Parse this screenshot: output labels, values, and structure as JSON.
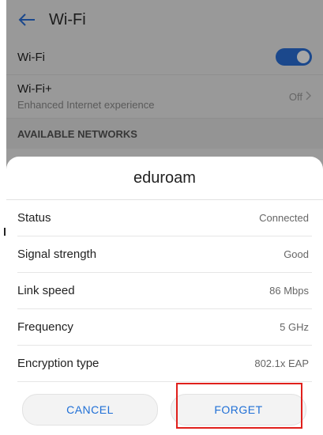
{
  "header": {
    "title": "Wi-Fi",
    "back_icon": "arrow-left-icon"
  },
  "settings": {
    "wifi_label": "Wi-Fi",
    "wifi_enabled": true,
    "wifiplus_label": "Wi-Fi+",
    "wifiplus_sub": "Enhanced Internet experience",
    "wifiplus_value": "Off",
    "section_header": "AVAILABLE NETWORKS"
  },
  "dialog": {
    "title": "eduroam",
    "rows": [
      {
        "label": "Status",
        "value": "Connected"
      },
      {
        "label": "Signal strength",
        "value": "Good"
      },
      {
        "label": "Link speed",
        "value": "86 Mbps"
      },
      {
        "label": "Frequency",
        "value": "5 GHz"
      },
      {
        "label": "Encryption type",
        "value": "802.1x EAP"
      }
    ],
    "cancel_label": "CANCEL",
    "forget_label": "FORGET"
  },
  "colors": {
    "accent": "#1f6fd6",
    "toggle_on": "#2a6fd8",
    "highlight": "#e0201c"
  }
}
